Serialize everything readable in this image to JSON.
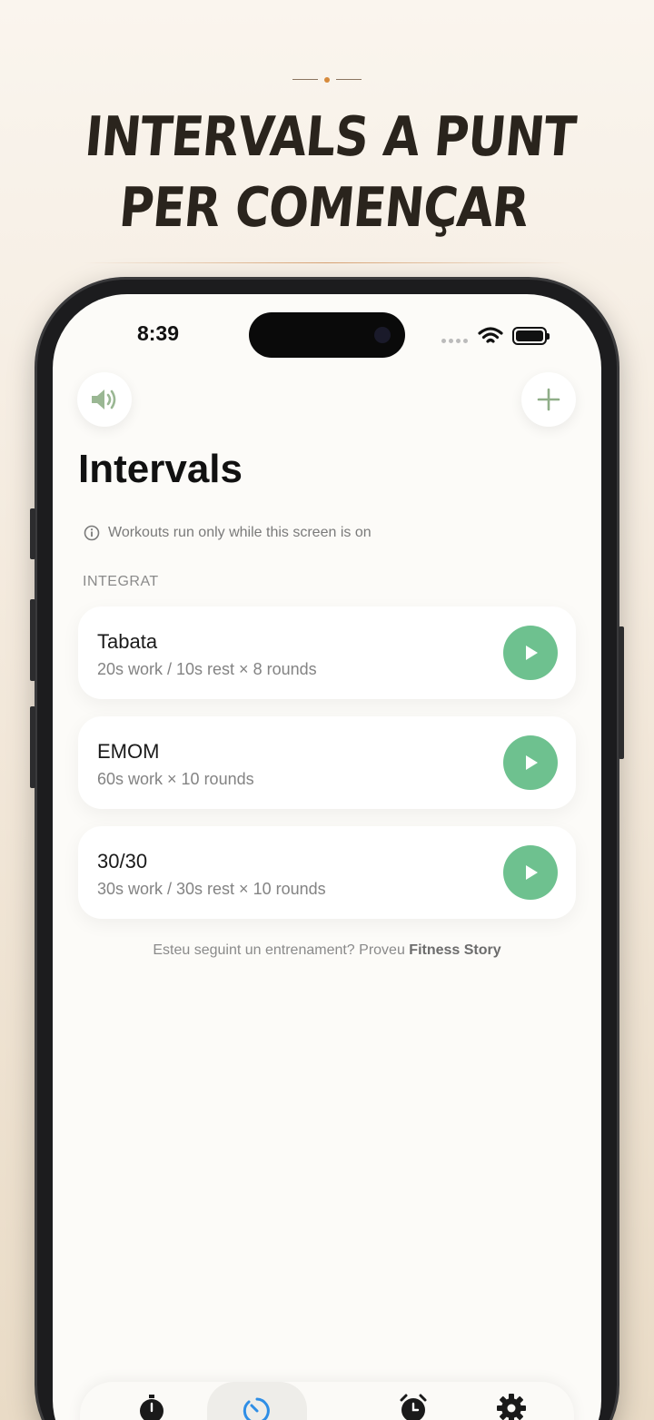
{
  "headline": {
    "line1": "INTERVALS A PUNT",
    "line2": "PER COMENÇAR"
  },
  "status_bar": {
    "time": "8:39"
  },
  "header": {
    "sound_icon": "speaker-volume-icon",
    "add_icon": "plus-icon",
    "title": "Intervals"
  },
  "notice": {
    "icon": "info-icon",
    "text": "Workouts run only while this screen is on"
  },
  "section": {
    "label": "INTEGRAT"
  },
  "workouts": [
    {
      "name": "Tabata",
      "detail": "20s work / 10s rest × 8 rounds"
    },
    {
      "name": "EMOM",
      "detail": "60s work × 10 rounds"
    },
    {
      "name": "30/30",
      "detail": "30s work / 30s rest × 10 rounds"
    }
  ],
  "footer": {
    "prefix": "Esteu seguint un entrenament? Proveu ",
    "link": "Fitness Story"
  },
  "tabs": [
    {
      "icon": "stopwatch-icon",
      "active": false
    },
    {
      "icon": "interval-timer-icon",
      "active": true
    },
    {
      "icon": "alarm-clock-icon",
      "active": false
    },
    {
      "icon": "gear-icon",
      "active": false
    }
  ],
  "colors": {
    "accent_green": "#6ec18f",
    "active_tab_blue": "#2e8ee6",
    "headline": "#2a241d",
    "ornament_dot": "#d68a3c"
  }
}
